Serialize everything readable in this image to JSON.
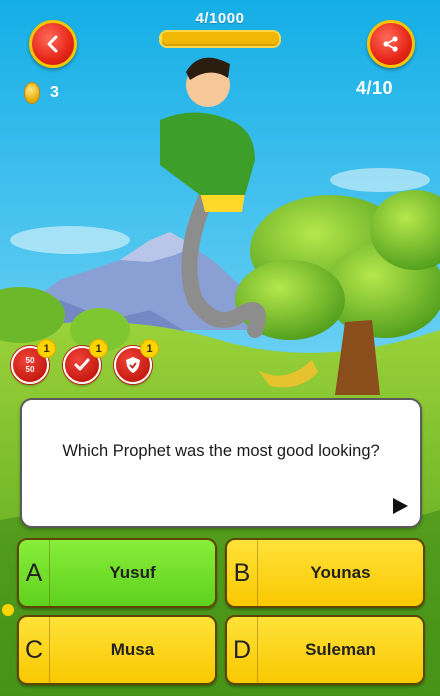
{
  "header": {
    "progress_text": "4/1000",
    "progress_fraction": 0.004
  },
  "coins": {
    "count": "3"
  },
  "question_counter": "4/10",
  "lifelines": [
    {
      "name": "50/50",
      "label_top": "50",
      "label_bottom": "50",
      "count": "1",
      "icon": "fifty-fifty-icon"
    },
    {
      "name": "correct-answer",
      "count": "1",
      "icon": "checkmark-icon"
    },
    {
      "name": "shield",
      "count": "1",
      "icon": "shield-icon"
    }
  ],
  "question": {
    "text": "Which Prophet was the most good looking?"
  },
  "answers": [
    {
      "letter": "A",
      "text": "Yusuf",
      "state": "correct"
    },
    {
      "letter": "B",
      "text": "Younas",
      "state": "default"
    },
    {
      "letter": "C",
      "text": "Musa",
      "state": "default"
    },
    {
      "letter": "D",
      "text": "Suleman",
      "state": "default"
    }
  ],
  "colors": {
    "sky_top": "#1fb4e8",
    "button_red": "#e52618",
    "accent_yellow": "#f9c800",
    "correct_green": "#5ed11e"
  }
}
